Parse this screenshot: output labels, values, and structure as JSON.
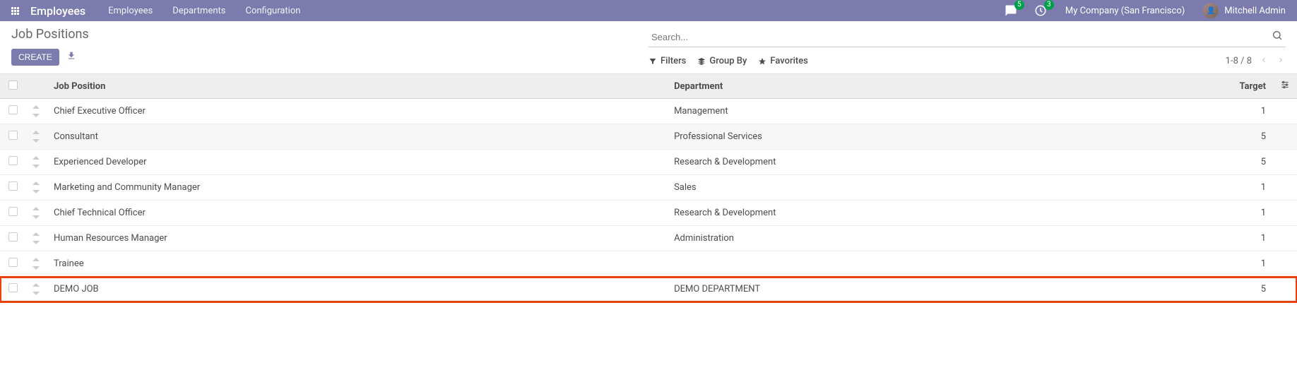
{
  "nav": {
    "brand": "Employees",
    "items": [
      "Employees",
      "Departments",
      "Configuration"
    ],
    "messages_count": "5",
    "activities_count": "3",
    "company": "My Company (San Francisco)",
    "user": "Mitchell Admin"
  },
  "breadcrumb": "Job Positions",
  "buttons": {
    "create": "CREATE"
  },
  "search": {
    "placeholder": "Search...",
    "filters": "Filters",
    "group_by": "Group By",
    "favorites": "Favorites"
  },
  "pager": {
    "range": "1-8 / 8"
  },
  "table": {
    "headers": {
      "job_position": "Job Position",
      "department": "Department",
      "target": "Target"
    },
    "rows": [
      {
        "position": "Chief Executive Officer",
        "department": "Management",
        "target": "1",
        "alt": false,
        "highlight": false
      },
      {
        "position": "Consultant",
        "department": "Professional Services",
        "target": "5",
        "alt": true,
        "highlight": false
      },
      {
        "position": "Experienced Developer",
        "department": "Research & Development",
        "target": "5",
        "alt": false,
        "highlight": false
      },
      {
        "position": "Marketing and Community Manager",
        "department": "Sales",
        "target": "1",
        "alt": false,
        "highlight": false
      },
      {
        "position": "Chief Technical Officer",
        "department": "Research & Development",
        "target": "1",
        "alt": false,
        "highlight": false
      },
      {
        "position": "Human Resources Manager",
        "department": "Administration",
        "target": "1",
        "alt": false,
        "highlight": false
      },
      {
        "position": "Trainee",
        "department": "",
        "target": "1",
        "alt": false,
        "highlight": false
      },
      {
        "position": "DEMO JOB",
        "department": "DEMO DEPARTMENT",
        "target": "5",
        "alt": false,
        "highlight": true
      }
    ]
  }
}
